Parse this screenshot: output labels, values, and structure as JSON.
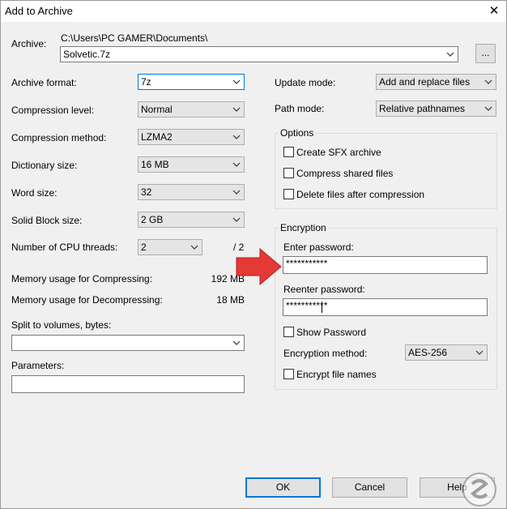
{
  "window": {
    "title": "Add to Archive",
    "close_glyph": "✕"
  },
  "archive": {
    "label": "Archive:",
    "path": "C:\\Users\\PC GAMER\\Documents\\",
    "name": "Solvetic.7z",
    "browse_label": "..."
  },
  "left": {
    "archive_format": {
      "label": "Archive format:",
      "value": "7z"
    },
    "compression_level": {
      "label": "Compression level:",
      "value": "Normal"
    },
    "compression_method": {
      "label": "Compression method:",
      "value": "LZMA2"
    },
    "dictionary_size": {
      "label": "Dictionary size:",
      "value": "16 MB"
    },
    "word_size": {
      "label": "Word size:",
      "value": "32"
    },
    "solid_block_size": {
      "label": "Solid Block size:",
      "value": "2 GB"
    },
    "cpu_threads": {
      "label": "Number of CPU threads:",
      "value": "2",
      "max": "/ 2"
    },
    "memory_compress": {
      "label": "Memory usage for Compressing:",
      "value": "192 MB"
    },
    "memory_decompress": {
      "label": "Memory usage for Decompressing:",
      "value": "18 MB"
    },
    "split": {
      "label": "Split to volumes, bytes:",
      "value": ""
    },
    "parameters": {
      "label": "Parameters:",
      "value": ""
    }
  },
  "right": {
    "update_mode": {
      "label": "Update mode:",
      "value": "Add and replace files"
    },
    "path_mode": {
      "label": "Path mode:",
      "value": "Relative pathnames"
    },
    "options": {
      "title": "Options",
      "create_sfx": {
        "label": "Create SFX archive",
        "checked": false
      },
      "compress_shared": {
        "label": "Compress shared files",
        "checked": false
      },
      "delete_after": {
        "label": "Delete files after compression",
        "checked": false
      }
    },
    "encryption": {
      "title": "Encryption",
      "enter_password_label": "Enter password:",
      "enter_password_value": "***********",
      "reenter_password_label": "Reenter password:",
      "reenter_password_value": "***********",
      "show_password": {
        "label": "Show Password",
        "checked": false
      },
      "method_label": "Encryption method:",
      "method_value": "AES-256",
      "encrypt_names": {
        "label": "Encrypt file names",
        "checked": false
      }
    }
  },
  "buttons": {
    "ok": "OK",
    "cancel": "Cancel",
    "help": "Help"
  },
  "annotation": {
    "arrow_color": "#e53935",
    "icon": "red-arrow-right"
  },
  "watermark": {
    "text": "Solvetic",
    "icon": "solvetic-logo"
  },
  "colors": {
    "focus": "#0078d7",
    "window_bg": "#f0f0f0"
  }
}
